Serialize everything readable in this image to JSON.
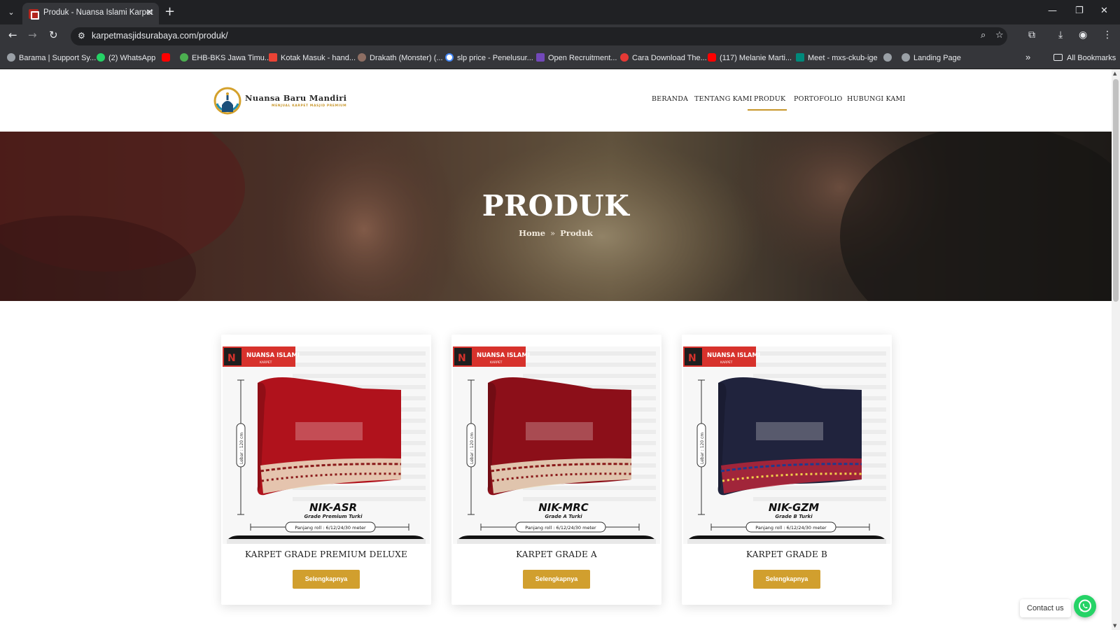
{
  "browser": {
    "tab_title": "Produk - Nuansa Islami Karpet",
    "url": "karpetmasjidsurabaya.com/produk/",
    "bookmarks": [
      "Barama | Support Sy...",
      "(2) WhatsApp",
      "",
      "EHB-BKS Jawa Timu...",
      "Kotak Masuk - hand...",
      "Drakath (Monster) (...",
      "slp price - Penelusur...",
      "Open Recruitment...",
      "Cara Download The...",
      "(117) Melanie Marti...",
      "Meet - mxs-ckub-ige",
      "",
      "Landing Page"
    ],
    "all_bookmarks": "All Bookmarks"
  },
  "site": {
    "logo_name": "Nuansa Baru Mandiri",
    "logo_tagline": "MENJUAL KARPET MASJID PREMIUM",
    "nav": [
      "BERANDA",
      "TENTANG KAMI",
      "PRODUK",
      "PORTOFOLIO",
      "HUBUNGI KAMI"
    ],
    "active_nav": "PRODUK"
  },
  "hero": {
    "title": "PRODUK",
    "breadcrumb_home": "Home",
    "breadcrumb_sep": "»",
    "breadcrumb_current": "Produk"
  },
  "products": [
    {
      "name": "KARPET GRADE PREMIUM DELUXE",
      "button": "Selengkapnya",
      "code": "NIK-ASR",
      "grade": "Grade Premium Turki",
      "brand": "NUANSA ISLAMI",
      "brand_sub": "KARPET",
      "width_label": "Lebar : 120 cm",
      "length_label": "Panjang roll : 6/12/24/30 meter",
      "carpet_color": "#b0121c"
    },
    {
      "name": "KARPET GRADE A",
      "button": "Selengkapnya",
      "code": "NIK-MRC",
      "grade": "Grade A Turki",
      "brand": "NUANSA ISLAMI",
      "brand_sub": "KARPET",
      "width_label": "Lebar : 120 cm",
      "length_label": "Panjang roll : 6/12/24/30 meter",
      "carpet_color": "#8c0f19"
    },
    {
      "name": "KARPET GRADE B",
      "button": "Selengkapnya",
      "code": "NIK-GZM",
      "grade": "Grade B Turki",
      "brand": "NUANSA ISLAMI",
      "brand_sub": "KARPET",
      "width_label": "Lebar : 120 cm",
      "length_label": "Panjang roll : 6/12/24/30 meter",
      "carpet_color": "#20233d"
    }
  ],
  "contact": {
    "label": "Contact us"
  },
  "colors": {
    "accent": "#c8962a",
    "button": "#d19f2e",
    "whatsapp": "#25d366"
  }
}
